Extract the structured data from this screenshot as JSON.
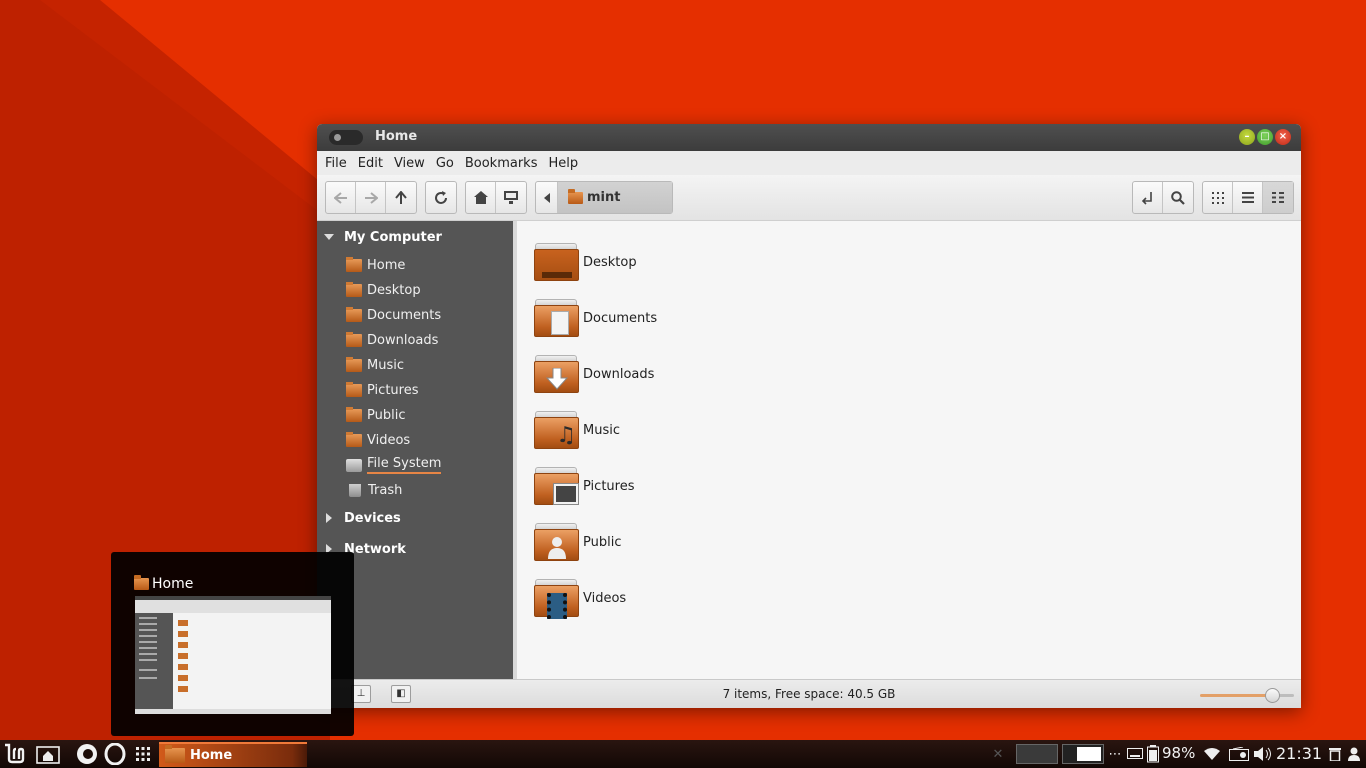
{
  "window": {
    "title": "Home",
    "menus": [
      "File",
      "Edit",
      "View",
      "Go",
      "Bookmarks",
      "Help"
    ],
    "path": "mint"
  },
  "sidebar": {
    "my_computer": "My Computer",
    "places": [
      "Home",
      "Desktop",
      "Documents",
      "Downloads",
      "Music",
      "Pictures",
      "Public",
      "Videos",
      "File System",
      "Trash"
    ],
    "devices": "Devices",
    "network": "Network"
  },
  "content": {
    "items": [
      {
        "name": "Desktop",
        "icon": "desktop-folder-icon"
      },
      {
        "name": "Documents",
        "icon": "documents-folder-icon"
      },
      {
        "name": "Downloads",
        "icon": "downloads-folder-icon"
      },
      {
        "name": "Music",
        "icon": "music-folder-icon"
      },
      {
        "name": "Pictures",
        "icon": "pictures-folder-icon"
      },
      {
        "name": "Public",
        "icon": "public-folder-icon"
      },
      {
        "name": "Videos",
        "icon": "videos-folder-icon"
      }
    ]
  },
  "statusbar": {
    "text": "7 items, Free space: 40.5 GB",
    "zoom_fraction": 0.78
  },
  "preview": {
    "title": "Home"
  },
  "panel": {
    "task_label": "Home",
    "battery": "98%",
    "clock": "21:31"
  },
  "colors": {
    "wallpaper": "#e52f00",
    "accent": "#e37a35",
    "sidebar": "#555555"
  }
}
